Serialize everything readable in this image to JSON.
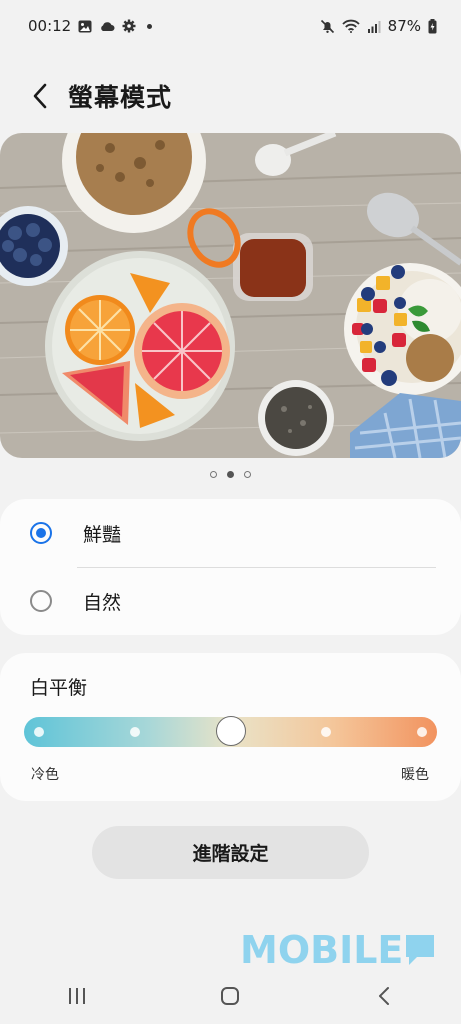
{
  "status_bar": {
    "time": "00:12",
    "battery": "87%",
    "left_icons": [
      "gallery-icon",
      "cloud-icon",
      "settings-icon",
      "dot-icon"
    ],
    "right_icons": [
      "mute-icon",
      "wifi-icon",
      "signal-icon",
      "battery-icon"
    ]
  },
  "header": {
    "title": "螢幕模式"
  },
  "preview": {
    "pages": 3,
    "active_page": 2
  },
  "modes": {
    "options": [
      {
        "label": "鮮豔",
        "selected": true
      },
      {
        "label": "自然",
        "selected": false
      }
    ]
  },
  "white_balance": {
    "title": "白平衡",
    "cool_label": "冷色",
    "warm_label": "暖色",
    "level": 2,
    "steps": 5
  },
  "advanced": {
    "label": "進階設定"
  },
  "watermark": {
    "text": "MOBILE"
  },
  "colors": {
    "accent": "#1a73e8",
    "background": "#f2f2f2",
    "card": "#fcfcfc"
  }
}
